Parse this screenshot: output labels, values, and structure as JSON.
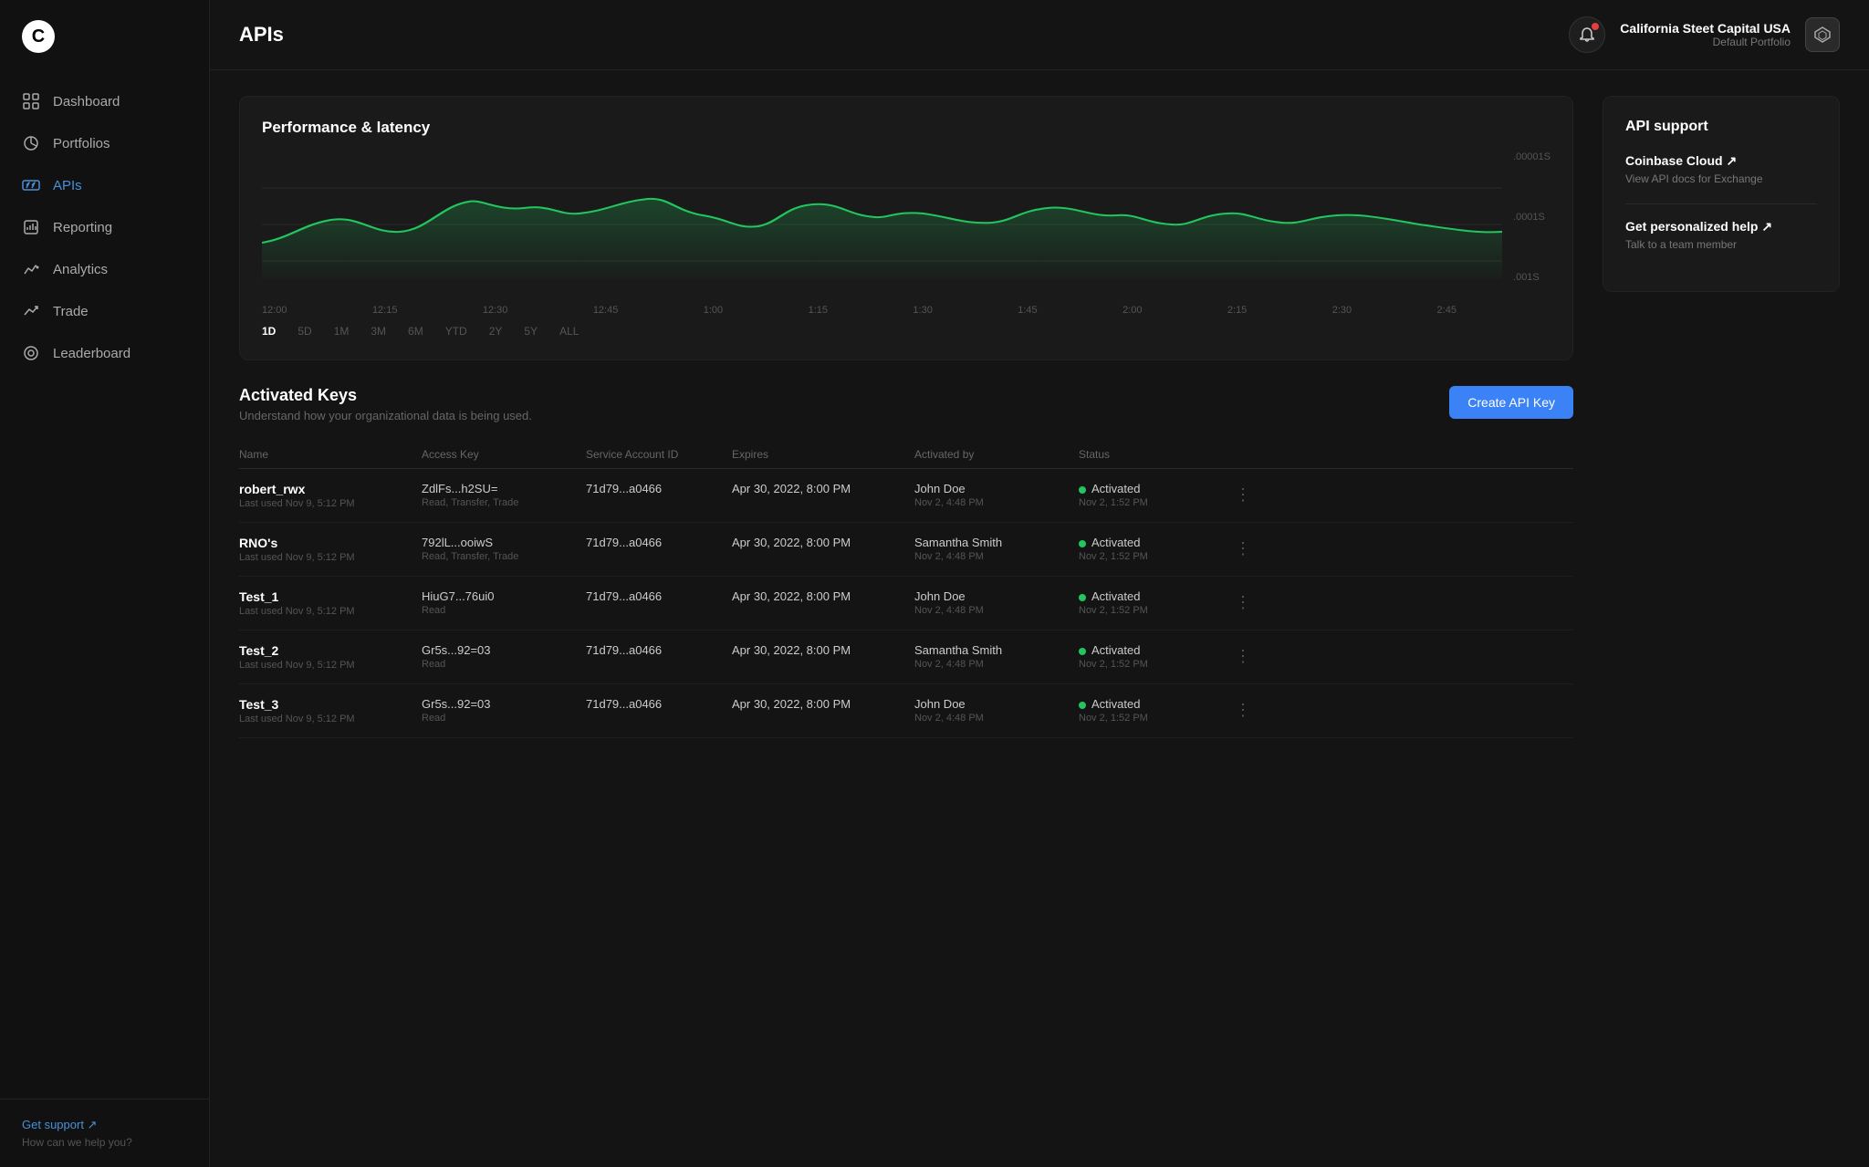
{
  "sidebar": {
    "logo": "C",
    "nav_items": [
      {
        "id": "dashboard",
        "label": "Dashboard",
        "active": false
      },
      {
        "id": "portfolios",
        "label": "Portfolios",
        "active": false
      },
      {
        "id": "apis",
        "label": "APIs",
        "active": true
      },
      {
        "id": "reporting",
        "label": "Reporting",
        "active": false
      },
      {
        "id": "analytics",
        "label": "Analytics",
        "active": false
      },
      {
        "id": "trade",
        "label": "Trade",
        "active": false
      },
      {
        "id": "leaderboard",
        "label": "Leaderboard",
        "active": false
      }
    ],
    "get_support_label": "Get support ↗",
    "support_sub": "How can we help you?"
  },
  "header": {
    "title": "APIs",
    "account_name": "California Steet Capital USA",
    "account_sub": "Default Portfolio"
  },
  "chart": {
    "title": "Performance & latency",
    "y_labels": [
      ".00001S",
      ".0001S",
      ".001S"
    ],
    "time_labels": [
      "12:00",
      "12:15",
      "12:30",
      "12:45",
      "1:00",
      "1:15",
      "1:30",
      "1:45",
      "2:00",
      "2:15",
      "2:30",
      "2:45"
    ],
    "period_tabs": [
      "1D",
      "5D",
      "1M",
      "3M",
      "6M",
      "YTD",
      "2Y",
      "5Y",
      "ALL"
    ],
    "active_period": "1D"
  },
  "activated_keys": {
    "title": "Activated Keys",
    "subtitle": "Understand how your organizational data is being used.",
    "create_button": "Create API Key",
    "columns": [
      "Name",
      "Access Key",
      "Service Account ID",
      "Expires",
      "Activated by",
      "Status"
    ],
    "rows": [
      {
        "name": "robert_rwx",
        "name_sub": "Last used Nov 9, 5:12 PM",
        "access_key": "ZdlFs...h2SU=",
        "access_sub": "Read, Transfer, Trade",
        "service_id": "71d79...a0466",
        "expires": "Apr 30, 2022, 8:00 PM",
        "activated_by": "John Doe",
        "activated_sub": "Nov 2, 4:48 PM",
        "status": "Activated",
        "status_sub": "Nov 2, 1:52 PM"
      },
      {
        "name": "RNO's",
        "name_sub": "Last used Nov 9, 5:12 PM",
        "access_key": "792lL...ooiwS",
        "access_sub": "Read, Transfer, Trade",
        "service_id": "71d79...a0466",
        "expires": "Apr 30, 2022, 8:00 PM",
        "activated_by": "Samantha Smith",
        "activated_sub": "Nov 2, 4:48 PM",
        "status": "Activated",
        "status_sub": "Nov 2, 1:52 PM"
      },
      {
        "name": "Test_1",
        "name_sub": "Last used Nov 9, 5:12 PM",
        "access_key": "HiuG7...76ui0",
        "access_sub": "Read",
        "service_id": "71d79...a0466",
        "expires": "Apr 30, 2022, 8:00 PM",
        "activated_by": "John Doe",
        "activated_sub": "Nov 2, 4:48 PM",
        "status": "Activated",
        "status_sub": "Nov 2, 1:52 PM"
      },
      {
        "name": "Test_2",
        "name_sub": "Last used Nov 9, 5:12 PM",
        "access_key": "Gr5s...92=03",
        "access_sub": "Read",
        "service_id": "71d79...a0466",
        "expires": "Apr 30, 2022, 8:00 PM",
        "activated_by": "Samantha Smith",
        "activated_sub": "Nov 2, 4:48 PM",
        "status": "Activated",
        "status_sub": "Nov 2, 1:52 PM"
      },
      {
        "name": "Test_3",
        "name_sub": "Last used Nov 9, 5:12 PM",
        "access_key": "Gr5s...92=03",
        "access_sub": "Read",
        "service_id": "71d79...a0466",
        "expires": "Apr 30, 2022, 8:00 PM",
        "activated_by": "John Doe",
        "activated_sub": "Nov 2, 4:48 PM",
        "status": "Activated",
        "status_sub": "Nov 2, 1:52 PM"
      }
    ]
  },
  "api_support": {
    "title": "API support",
    "coinbase_cloud": {
      "label": "Coinbase Cloud ↗",
      "desc": "View API docs for Exchange"
    },
    "personalized_help": {
      "label": "Get personalized help ↗",
      "desc": "Talk to a team member"
    }
  }
}
